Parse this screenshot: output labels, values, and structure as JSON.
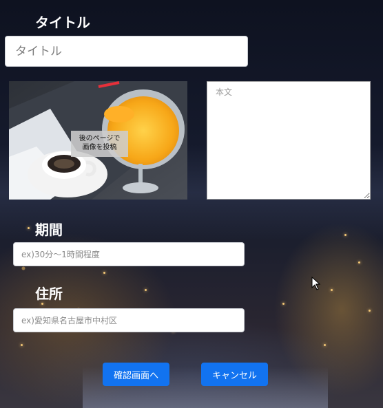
{
  "form": {
    "title_label": "タイトル",
    "title_placeholder": "タイトル",
    "image_caption_line1": "後のページで",
    "image_caption_line2": "画像を投稿",
    "body_placeholder": "本文",
    "period_label": "期間",
    "period_placeholder": "ex)30分〜1時間程度",
    "address_label": "住所",
    "address_placeholder": "ex)愛知県名古屋市中村区"
  },
  "actions": {
    "confirm_label": "確認画面へ",
    "cancel_label": "キャンセル"
  },
  "colors": {
    "accent": "#1273f0",
    "label_text": "#ffffff",
    "background": "#141724"
  },
  "icons": {
    "cursor": "mouse-pointer-icon"
  }
}
